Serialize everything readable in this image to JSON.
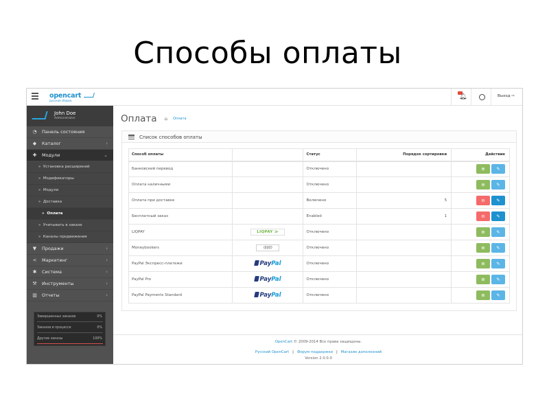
{
  "slide": {
    "title": "Способы оплаты"
  },
  "header": {
    "logo_text": "opencart",
    "logo_subtext": "русская сборка",
    "logout_label": "Выход"
  },
  "sidebar": {
    "profile": {
      "name": "John Doe",
      "role": "Administrator"
    },
    "items": [
      {
        "label": "Панель состояния",
        "icon": "dashboard-icon",
        "arrow": ""
      },
      {
        "label": "Каталог",
        "icon": "tag-icon",
        "arrow": "›"
      },
      {
        "label": "Модули",
        "icon": "puzzle-icon",
        "arrow": "⌄"
      },
      {
        "label": "Установка расширений",
        "bullet": "»"
      },
      {
        "label": "Модификаторы",
        "bullet": "»"
      },
      {
        "label": "Модули",
        "bullet": "»"
      },
      {
        "label": "Доставка",
        "bullet": "»"
      },
      {
        "label": "Оплата",
        "bullet": "»"
      },
      {
        "label": "Учитывать в заказе",
        "bullet": "»"
      },
      {
        "label": "Каналы продвижения",
        "bullet": "»"
      },
      {
        "label": "Продажи",
        "icon": "cart-icon",
        "arrow": "›"
      },
      {
        "label": "Маркетинг",
        "icon": "share-icon",
        "arrow": "›"
      },
      {
        "label": "Система",
        "icon": "cog-icon",
        "arrow": "›"
      },
      {
        "label": "Инструменты",
        "icon": "wrench-icon",
        "arrow": "›"
      },
      {
        "label": "Отчеты",
        "icon": "bar-chart-icon",
        "arrow": "›"
      }
    ],
    "stats": [
      {
        "label": "Завершенных заказов",
        "value": "0%",
        "fill": 0
      },
      {
        "label": "Заказов в процессе",
        "value": "0%",
        "fill": 0
      },
      {
        "label": "Другие заказы",
        "value": "100%",
        "fill": 1
      }
    ]
  },
  "page": {
    "title": "Оплата",
    "breadcrumb": "Оплата",
    "panel_title": "Список способов оплаты"
  },
  "table": {
    "headers": [
      "Способ оплаты",
      "",
      "Статус",
      "Порядок сортировки",
      "Действие"
    ],
    "rows": [
      {
        "name": "Банковский перевод",
        "logo": "",
        "status": "Отключено",
        "sort": "",
        "installed": false,
        "edit_strong": false
      },
      {
        "name": "Оплата наличными",
        "logo": "",
        "status": "Отключено",
        "sort": "",
        "installed": false,
        "edit_strong": false
      },
      {
        "name": "Оплата при доставке",
        "logo": "",
        "status": "Включено",
        "sort": "5",
        "installed": true,
        "edit_strong": true
      },
      {
        "name": "Бесплатный заказ",
        "logo": "",
        "status": "Enabled",
        "sort": "1",
        "installed": true,
        "edit_strong": true
      },
      {
        "name": "LIQPAY",
        "logo": "liqpay",
        "logo_text": "LIQPAY",
        "status": "Отключено",
        "sort": "",
        "installed": false,
        "edit_strong": false
      },
      {
        "name": "Moneybookers",
        "logo": "moneybookers",
        "logo_text": "((((((O",
        "status": "Отключено",
        "sort": "",
        "installed": false,
        "edit_strong": false
      },
      {
        "name": "PayPal Экспресс-платежи",
        "logo": "paypal",
        "status": "Отключено",
        "sort": "",
        "installed": false,
        "edit_strong": false
      },
      {
        "name": "PayPal Pro",
        "logo": "paypal",
        "status": "Отключено",
        "sort": "",
        "installed": false,
        "edit_strong": false
      },
      {
        "name": "PayPal Payments Standard",
        "logo": "paypal",
        "status": "Отключено",
        "sort": "",
        "installed": false,
        "edit_strong": false
      }
    ]
  },
  "footer": {
    "copyright_link": "OpenCart",
    "copyright_text": "© 2009-2014 Все права защищены.",
    "links": [
      "Русский OpenCart",
      "Форум поддержки",
      "Магазин дополнений"
    ],
    "version": "Version 2.0.0.0"
  },
  "colors": {
    "accent": "#1e91cf",
    "install_green": "#8fbb5f",
    "uninstall_red": "#f56b6b",
    "sidebar_bg": "#515151"
  }
}
